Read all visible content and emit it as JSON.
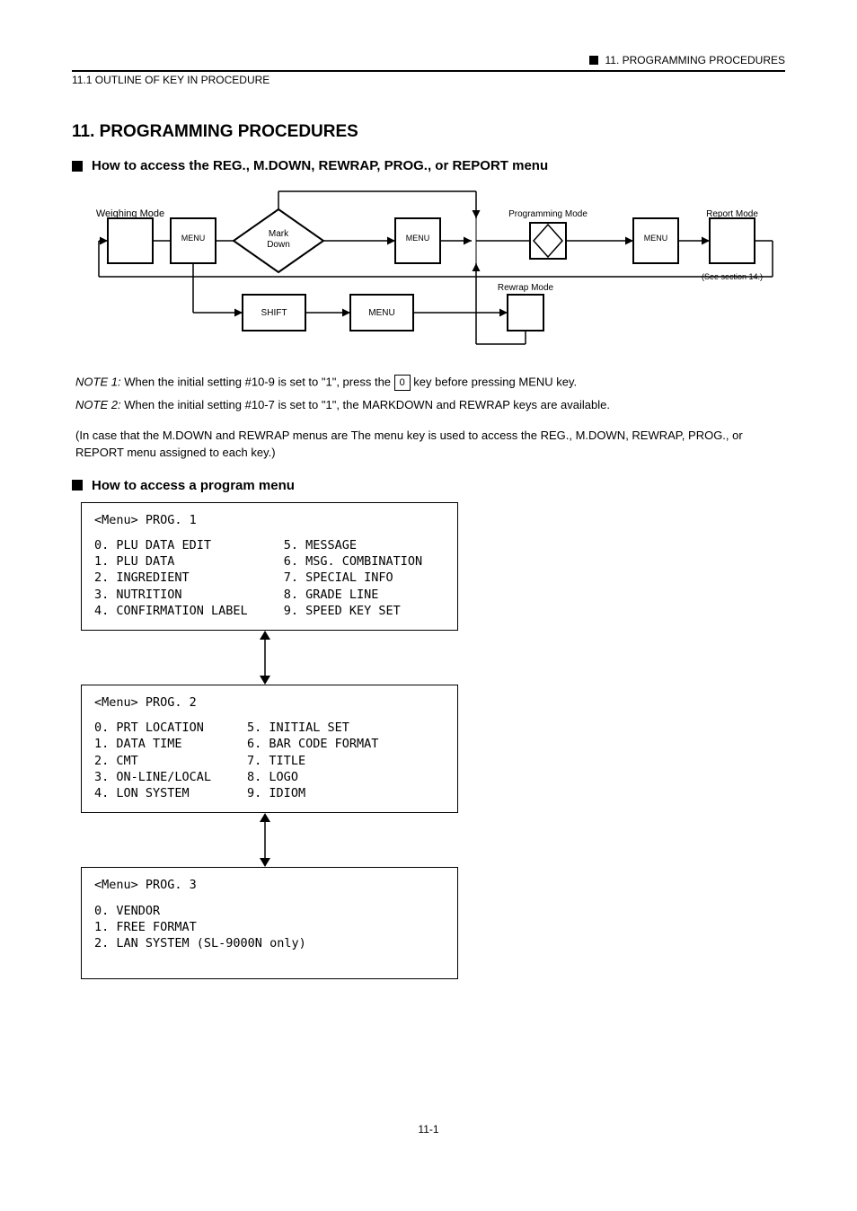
{
  "header": {
    "right_line": "11. PROGRAMMING PROCEDURES",
    "sub": "11.1 OUTLINE OF KEY IN PROCEDURE"
  },
  "section_title": "11. PROGRAMMING PROCEDURES",
  "subhead1": "How to access the REG., M.DOWN, REWRAP, PROG., or REPORT menu",
  "desc": "The menu key is used to access the REG., M.DOWN, REWRAP, PROG., or REPORT menu assigned to each key.)",
  "flow": {
    "weigh_mode": "Weighing Mode",
    "menu": "MENU",
    "mark_down": "Mark Down",
    "shift": "Shift",
    "programming_mode": "Programming Mode",
    "report_mode": "Report Mode",
    "rewrap_mode": "Rewrap Mode",
    "note_inline": "(See section 14.)",
    "note1_prefix": "NOTE 1:",
    "note1_text": "When the initial setting #10-9 is set to \"1\", press the",
    "note1_key": "0",
    "note1_tail": "key before pressing MENU key.",
    "note2_prefix": "NOTE 2:",
    "note2_text": "When the initial setting #10-7 is set to \"1\", the MARKDOWN and REWRAP keys are available.",
    "read_me": "(In case that the M.DOWN and REWRAP menus are"
  },
  "subhead2": "How to access a program menu",
  "menu1": {
    "title": "<Menu>  PROG. 1",
    "left": [
      "0. PLU DATA EDIT",
      "1. PLU DATA",
      "2. INGREDIENT",
      "3. NUTRITION",
      "4. CONFIRMATION LABEL"
    ],
    "right": [
      "5. MESSAGE",
      "6. MSG. COMBINATION",
      "7. SPECIAL INFO",
      "8. GRADE LINE",
      "9. SPEED KEY SET"
    ]
  },
  "menu2": {
    "title": "<Menu>  PROG. 2",
    "left": [
      "0. PRT LOCATION",
      "1. DATA TIME",
      "2. CMT",
      "3. ON-LINE/LOCAL",
      "4. LON SYSTEM"
    ],
    "right": [
      "5. INITIAL SET",
      "6. BAR CODE FORMAT",
      "7. TITLE",
      "8. LOGO",
      "9. IDIOM"
    ]
  },
  "menu3": {
    "title": "<Menu>  PROG. 3",
    "left": [
      "0. VENDOR",
      "1. FREE FORMAT",
      "2. LAN SYSTEM (SL-9000N only)"
    ]
  },
  "footer_page": "11-1"
}
